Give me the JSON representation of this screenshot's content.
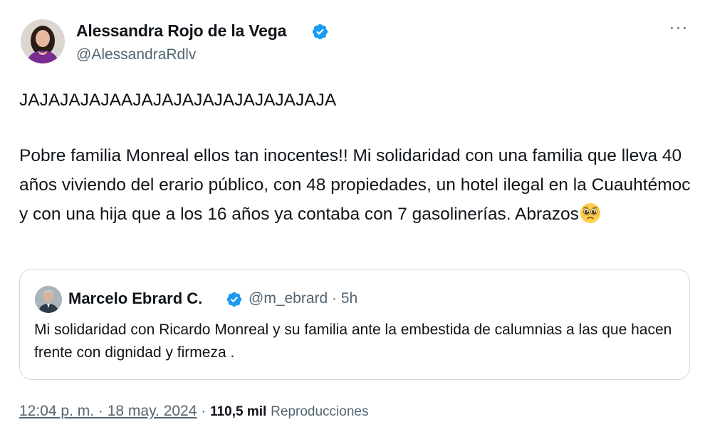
{
  "tweet": {
    "display_name": "Alessandra Rojo de la Vega",
    "handle": "@AlessandraRdlv",
    "verified_icon": "verified-badge-icon",
    "more_icon": "more-options-icon",
    "more_label": "···",
    "body": {
      "line1": "JAJAJAJAJAAJAJAJAJAJAJAJAJAJAJA",
      "paragraph2": "Pobre familia Monreal ellos tan inocentes!! Mi solidaridad con una familia que lleva 40 años viviendo del erario público, con 48 propiedades, un hotel ilegal en la Cuauhtémoc y con una hija que a los 16 años ya contaba con 7 gasolinerías. Abrazos",
      "emoji": "pleading-face-emoji"
    },
    "quoted": {
      "display_name": "Marcelo Ebrard C.",
      "meta": "@m_ebrard · 5h",
      "text": "Mi solidaridad con Ricardo Monreal y su familia ante la embestida de calumnias a las que hacen frente con dignidad y firmeza ."
    },
    "footer": {
      "timestamp": "12:04 p. m. · 18 may. 2024",
      "separator": " · ",
      "views_count": "110,5 mil",
      "views_label": "Reproducciones"
    }
  },
  "colors": {
    "verified": "#1d9bf0",
    "secondary_text": "#536471",
    "primary_text": "#0f1419",
    "border": "#cfd9de"
  }
}
